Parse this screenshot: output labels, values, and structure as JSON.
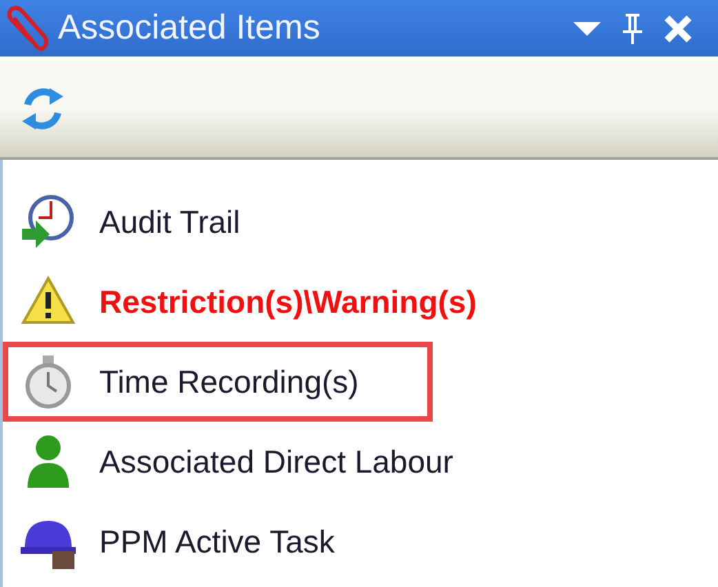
{
  "window": {
    "title": "Associated Items"
  },
  "items": [
    {
      "label": "Audit Trail",
      "kind": "audit",
      "alert": false,
      "highlighted": false
    },
    {
      "label": "Restriction(s)\\Warning(s)",
      "kind": "warning",
      "alert": true,
      "highlighted": false
    },
    {
      "label": "Time Recording(s)",
      "kind": "stopwatch",
      "alert": false,
      "highlighted": true
    },
    {
      "label": "Associated Direct Labour",
      "kind": "person",
      "alert": false,
      "highlighted": false
    },
    {
      "label": "PPM Active Task",
      "kind": "hardhat",
      "alert": false,
      "highlighted": false
    }
  ]
}
